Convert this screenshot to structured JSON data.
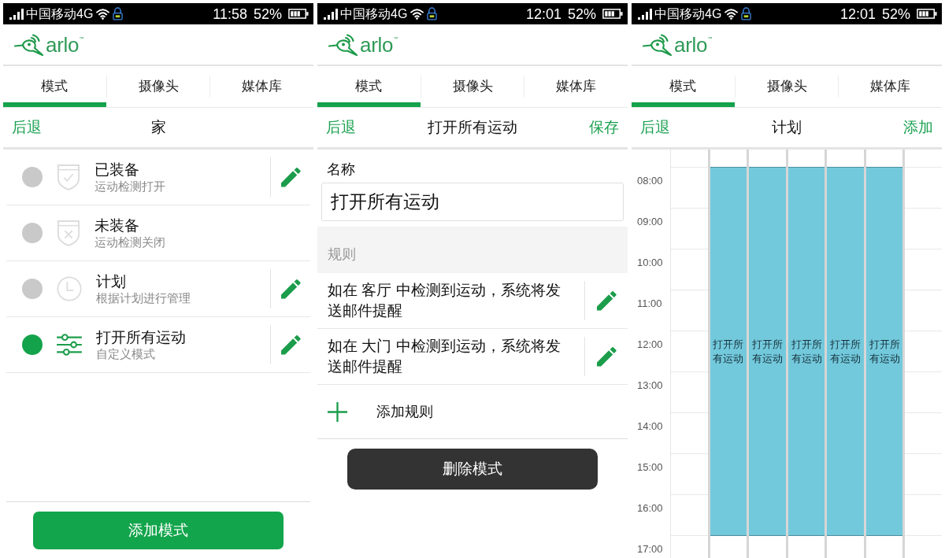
{
  "screens": [
    {
      "kind": "mode_list",
      "status_bar": {
        "carrier": "中国移动4G",
        "time": "11:58",
        "battery": "52%"
      },
      "logo": "arlo$^{™}$",
      "tabs": [
        {
          "label": "模式",
          "selected": true
        },
        {
          "label": "摄像头",
          "selected": false
        },
        {
          "label": "媒体库",
          "selected": false
        }
      ],
      "header": {
        "back": "后退",
        "title": "家"
      },
      "modes": [
        {
          "kind": "armed",
          "title": "已装备",
          "subtitle": "运动检测打开",
          "selected": false,
          "editable": true
        },
        {
          "kind": "disarmed",
          "title": "未装备",
          "subtitle": "运动检测关闭",
          "selected": false,
          "editable": false
        },
        {
          "kind": "schedule",
          "title": "计划",
          "subtitle": "根据计划进行管理",
          "selected": false,
          "editable": true
        },
        {
          "kind": "custom",
          "title": "打开所有运动",
          "subtitle": "自定义模式",
          "selected": true,
          "editable": true
        }
      ],
      "add_button": "添加模式"
    },
    {
      "kind": "mode_edit",
      "status_bar": {
        "carrier": "中国移动4G",
        "time": "12:01",
        "battery": "52%"
      },
      "logo": "arlo$^{™}$",
      "tabs": [
        {
          "label": "模式",
          "selected": true
        },
        {
          "label": "摄像头",
          "selected": false
        },
        {
          "label": "媒体库",
          "selected": false
        }
      ],
      "header": {
        "back": "后退",
        "title": "打开所有运动",
        "action": "保存"
      },
      "name_field": {
        "label": "名称",
        "value": "打开所有运动"
      },
      "rules_heading": "规则",
      "rules": [
        {
          "text": "如在 客厅 中检测到运动，系统将发送邮件提醒",
          "editable": true
        },
        {
          "text": "如在 大门 中检测到运动，系统将发送邮件提醒",
          "editable": true
        }
      ],
      "add_rule": "添加规则",
      "delete_button": "删除模式"
    },
    {
      "kind": "schedule",
      "status_bar": {
        "carrier": "中国移动4G",
        "time": "12:01",
        "battery": "52%"
      },
      "logo": "arlo$^{™}$",
      "tabs": [
        {
          "label": "模式",
          "selected": true
        },
        {
          "label": "摄像头",
          "selected": false
        },
        {
          "label": "媒体库",
          "selected": false
        }
      ],
      "header": {
        "back": "后退",
        "title": "计划",
        "action": "添加"
      },
      "schedule": {
        "times": [
          "08:00",
          "09:00",
          "10:00",
          "11:00",
          "12:00",
          "13:00",
          "14:00",
          "15:00",
          "16:00",
          "17:00"
        ],
        "days": [
          {
            "kind": "empty"
          },
          {
            "kind": "event",
            "label": "打开所有运动"
          },
          {
            "kind": "event",
            "label": "打开所有运动"
          },
          {
            "kind": "event",
            "label": "打开所有运动"
          },
          {
            "kind": "event",
            "label": "打开所有运动"
          },
          {
            "kind": "event",
            "label": "打开所有运动"
          },
          {
            "kind": "empty"
          }
        ]
      }
    }
  ]
}
